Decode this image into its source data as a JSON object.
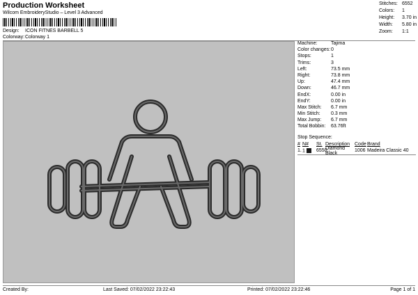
{
  "header": {
    "title": "Production Worksheet",
    "software": "Wilcom EmbroideryStudio – Level 3 Advanced",
    "design_label": "Design:",
    "design_value": "ICON FITNES BARBELL 5",
    "colorway_label": "Colorway:",
    "colorway_value": "Colorway 1"
  },
  "stats": [
    {
      "k": "Stitches:",
      "v": "6552"
    },
    {
      "k": "Colors:",
      "v": "1"
    },
    {
      "k": "Height:",
      "v": "3.70 in"
    },
    {
      "k": "Width:",
      "v": "5.80 in"
    },
    {
      "k": "Zoom:",
      "v": "1:1"
    }
  ],
  "info": [
    {
      "k": "Machine:",
      "v": "Tajima"
    },
    {
      "k": "Color changes:",
      "v": "0"
    },
    {
      "k": "Stops:",
      "v": "1"
    },
    {
      "k": "Trims:",
      "v": "3"
    },
    {
      "k": "Left:",
      "v": "73.5 mm"
    },
    {
      "k": "Right:",
      "v": "73.8 mm"
    },
    {
      "k": "Up:",
      "v": "47.4 mm"
    },
    {
      "k": "Down:",
      "v": "46.7 mm"
    },
    {
      "k": "EndX:",
      "v": "0.00 in"
    },
    {
      "k": "EndY:",
      "v": "0.00 in"
    },
    {
      "k": "Max Stitch:",
      "v": "6.7 mm"
    },
    {
      "k": "Min Stitch:",
      "v": "0.3 mm"
    },
    {
      "k": "Max Jump:",
      "v": "6.7 mm"
    },
    {
      "k": "Total Bobbin:",
      "v": "63.76ft"
    }
  ],
  "stop_sequence": {
    "title": "Stop Sequence:",
    "headers": {
      "num": "#",
      "n": "N#",
      "st": "St.",
      "desc": "Description",
      "code": "Code",
      "brand": "Brand"
    },
    "rows": [
      {
        "num": "1.",
        "n": "1",
        "st": "6550",
        "desc": "Diamond Black",
        "code": "1006",
        "brand": "Madeira Classic 40",
        "color": "#1a1a1a"
      }
    ]
  },
  "footer": {
    "created_by": "Created By:",
    "last_saved": "Last Saved: 07/02/2022 23:22:43",
    "printed": "Printed: 07/02/2022 23:22:46",
    "page": "Page 1 of 1"
  },
  "colors": {
    "panel_bg": "#c0c0c0",
    "thread": "#2b2b2b",
    "thread_inner": "#6a6a6a"
  }
}
